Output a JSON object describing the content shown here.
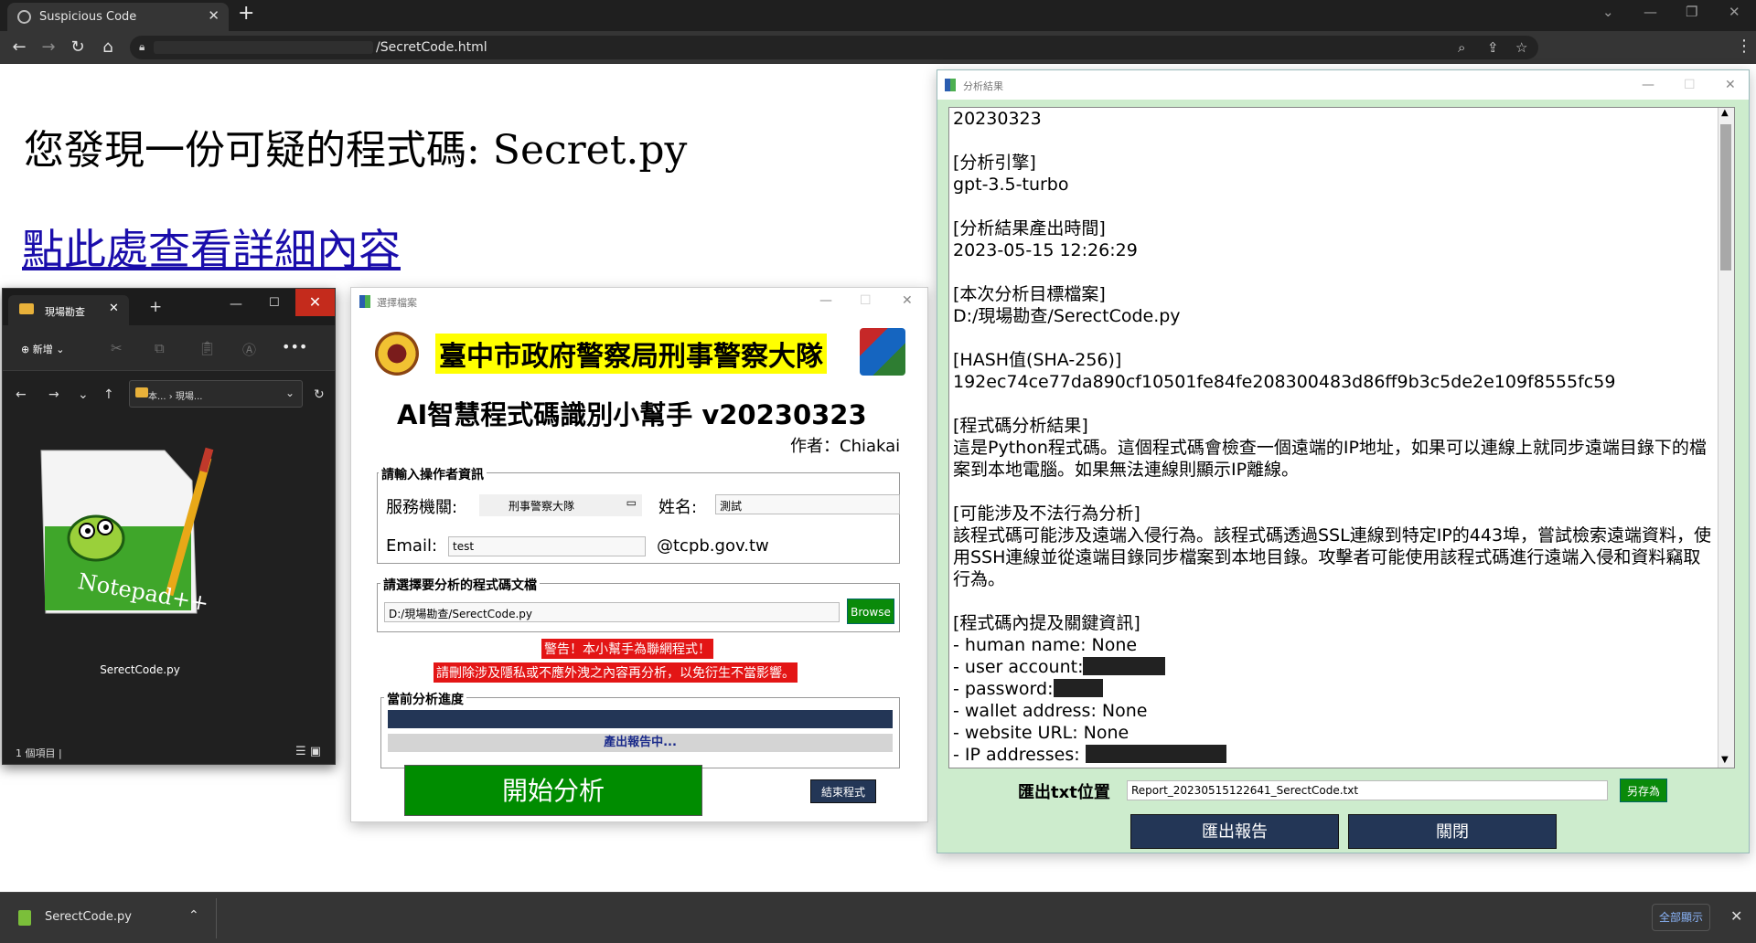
{
  "browser": {
    "tab_title": "Suspicious Code",
    "url": "/SecretCode.html",
    "new_tab": "+",
    "close": "✕"
  },
  "page": {
    "heading": "您發現一份可疑的程式碼: Secret.py",
    "link": "點此處查看詳細內容"
  },
  "explorer": {
    "tab_title": "現場勘查",
    "new_label": "新增",
    "breadcrumb": "本... › 現場...",
    "file_name": "SerectCode.py",
    "status": "1 個項目"
  },
  "selector": {
    "window_title": "選擇檔案",
    "agency_banner": "臺中市政府警察局刑事警察大隊",
    "app_title": "AI智慧程式碼識別小幫手 v20230323",
    "author": "作者：Chiakai",
    "group_operator": "請輸入操作者資訊",
    "label_agency": "服務機關:",
    "agency_value": "刑事警察大隊",
    "label_name": "姓名:",
    "name_value": "測試",
    "label_email": "Email:",
    "email_value": "test",
    "email_domain": "@tcpb.gov.tw",
    "group_file": "請選擇要分析的程式碼文檔",
    "file_path": "D:/現場勘查/SerectCode.py",
    "browse": "Browse",
    "warning1": "警告！本小幫手為聯網程式！",
    "warning2": "請刪除涉及隱私或不應外洩之內容再分析，以免衍生不當影響。",
    "group_progress": "當前分析進度",
    "progress_text": "產出報告中...",
    "progress_fraction": 1.0,
    "start": "開始分析",
    "exit": "結束程式"
  },
  "result": {
    "window_title": "分析結果",
    "lines": {
      "date": "20230323",
      "engine_h": "[分析引擎]",
      "engine": "gpt-3.5-turbo",
      "time_h": "[分析結果產出時間]",
      "time": "2023-05-15 12:26:29",
      "target_h": "[本次分析目標檔案]",
      "target": "D:/現場勘查/SerectCode.py",
      "hash_h": "[HASH值(SHA-256)]",
      "hash": "192ec74ce77da890cf10501fe84fe208300483d86ff9b3c5de2e109f8555fc59",
      "analysis_h": "[程式碼分析結果]",
      "analysis": "這是Python程式碼。這個程式碼會檢查一個遠端的IP地址，如果可以連線上就同步遠端目錄下的檔案到本地電腦。如果無法連線則顯示IP離線。",
      "illegal_h": "[可能涉及不法行為分析]",
      "illegal": "該程式碼可能涉及遠端入侵行為。該程式碼透過SSL連線到特定IP的443埠，嘗試檢索遠端資料，使用SSH連線並從遠端目錄同步檔案到本地目錄。攻擊者可能使用該程式碼進行遠端入侵和資料竊取行為。",
      "keyinfo_h": "[程式碼內提及關鍵資訊]",
      "k1": "- human name: None",
      "k2": "- user account:",
      "k3": "- password:",
      "k4": "- wallet address: None",
      "k5": "- website URL: None",
      "k6": "- IP addresses:"
    },
    "export_label": "匯出txt位置",
    "export_path": "Report_20230515122641_SerectCode.txt",
    "save_as": "另存為",
    "export_btn": "匯出報告",
    "close_btn": "關閉"
  },
  "downloads": {
    "file": "SerectCode.py",
    "show_all": "全部顯示"
  }
}
